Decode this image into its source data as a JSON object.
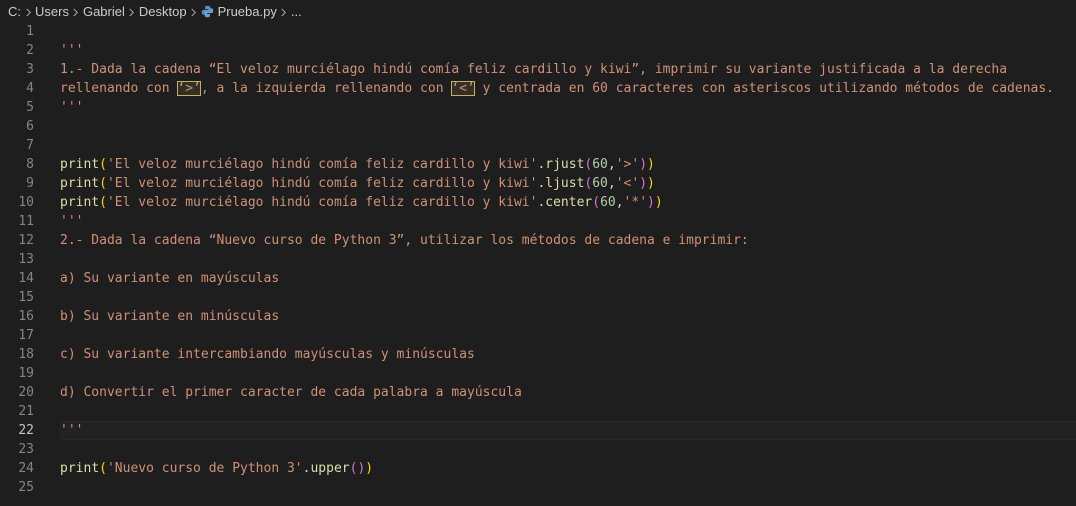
{
  "breadcrumb": {
    "items": [
      "C:",
      "Users",
      "Gabriel",
      "Desktop",
      "Prueba.py",
      "..."
    ]
  },
  "editor": {
    "current_line": 22,
    "lines": [
      {
        "n": "1",
        "text": ""
      },
      {
        "n": "2",
        "text": "'''"
      },
      {
        "n": "3",
        "text": "1.- Dada la cadena “El veloz murciélago hindú comía feliz cardillo y kiwi”, imprimir su variante justificada a la derecha"
      },
      {
        "n": "4",
        "a": "rellenando con ",
        "b": "‘>’",
        "c": ", a la izquierda rellenando con ",
        "d": "‘<’",
        "e": " y centrada en 60 caracteres con asteriscos utilizando métodos de cadenas."
      },
      {
        "n": "5",
        "text": "'''"
      },
      {
        "n": "6",
        "text": ""
      },
      {
        "n": "7",
        "text": ""
      },
      {
        "n": "8",
        "fn": "print",
        "s": "'El veloz murciélago hindú comía feliz cardillo y kiwi'",
        "m": ".rjust",
        "num": "60",
        "arg": "'>'"
      },
      {
        "n": "9",
        "fn": "print",
        "s": "'El veloz murciélago hindú comía feliz cardillo y kiwi'",
        "m": ".ljust",
        "num": "60",
        "arg": "'<'"
      },
      {
        "n": "10",
        "fn": "print",
        "s": "'El veloz murciélago hindú comía feliz cardillo y kiwi'",
        "m": ".center",
        "num": "60",
        "arg": "'*'"
      },
      {
        "n": "11",
        "text": "'''"
      },
      {
        "n": "12",
        "text": "2.- Dada la cadena “Nuevo curso de Python 3”, utilizar los métodos de cadena e imprimir:"
      },
      {
        "n": "13",
        "text": ""
      },
      {
        "n": "14",
        "text": "a) Su variante en mayúsculas"
      },
      {
        "n": "15",
        "text": ""
      },
      {
        "n": "16",
        "text": "b) Su variante en minúsculas"
      },
      {
        "n": "17",
        "text": ""
      },
      {
        "n": "18",
        "text": "c) Su variante intercambiando mayúsculas y minúsculas"
      },
      {
        "n": "19",
        "text": ""
      },
      {
        "n": "20",
        "text": "d) Convertir el primer caracter de cada palabra a mayúscula"
      },
      {
        "n": "21",
        "text": ""
      },
      {
        "n": "22",
        "text": "'''"
      },
      {
        "n": "23",
        "text": ""
      },
      {
        "n": "24",
        "fn": "print",
        "s": "'Nuevo curso de Python 3'",
        "m": ".upper"
      },
      {
        "n": "25",
        "text": ""
      }
    ]
  },
  "icons": {
    "separator": "chevron-right-icon",
    "file": "python-file-icon"
  },
  "colors": {
    "background": "#1e1e1e",
    "line_number": "#858585",
    "string": "#ce9178",
    "function": "#dcdcaa",
    "bracket1": "#ffd700",
    "bracket2": "#da70d6",
    "number": "#b5cea8"
  }
}
